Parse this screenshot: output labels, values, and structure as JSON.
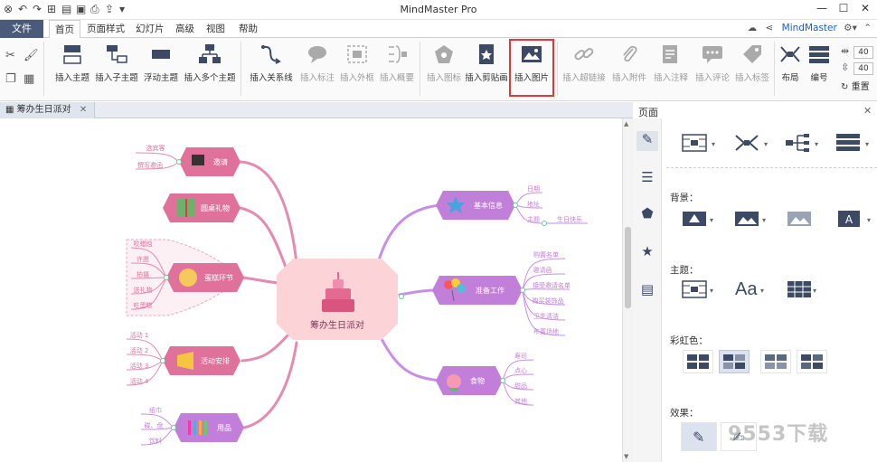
{
  "titlebar": {
    "app_title": "MindMaster Pro",
    "quick_access": [
      "app-logo-icon",
      "undo-icon",
      "redo-icon",
      "new-icon",
      "open-icon",
      "save-icon",
      "print-icon",
      "export-icon",
      "more-icon"
    ]
  },
  "menu": {
    "file": "文件",
    "tabs": [
      "首页",
      "页面样式",
      "幻灯片",
      "高级",
      "视图",
      "帮助"
    ],
    "active_tab": "首页",
    "user": "MindMaster"
  },
  "ribbon": {
    "buttons": [
      {
        "id": "insert-topic",
        "label": "插入主题"
      },
      {
        "id": "insert-subtopic",
        "label": "插入子主题"
      },
      {
        "id": "floating-topic",
        "label": "浮动主题"
      },
      {
        "id": "insert-multiple-topics",
        "label": "插入多个主题"
      },
      {
        "id": "insert-relationship",
        "label": "插入关系线"
      },
      {
        "id": "insert-callout",
        "label": "插入标注"
      },
      {
        "id": "insert-boundary",
        "label": "插入外框"
      },
      {
        "id": "insert-summary",
        "label": "插入概要"
      },
      {
        "id": "insert-icon",
        "label": "插入图标"
      },
      {
        "id": "insert-clipart",
        "label": "插入剪贴画"
      },
      {
        "id": "insert-picture",
        "label": "插入图片"
      },
      {
        "id": "insert-hyperlink",
        "label": "插入超链接"
      },
      {
        "id": "insert-attachment",
        "label": "插入附件"
      },
      {
        "id": "insert-note",
        "label": "插入注释"
      },
      {
        "id": "insert-comment",
        "label": "插入评论"
      },
      {
        "id": "insert-tag",
        "label": "插入标签"
      },
      {
        "id": "layout",
        "label": "布局"
      },
      {
        "id": "numbering",
        "label": "编号"
      },
      {
        "id": "reset",
        "label": "重置"
      }
    ],
    "spacing_h": "40",
    "spacing_v": "40"
  },
  "doc": {
    "tab_title": "筹办生日派对"
  },
  "mindmap": {
    "center": "筹办生日派对",
    "left_topics": [
      {
        "label": "邀请",
        "children": [
          "选宾客",
          "撰写邀函"
        ]
      },
      {
        "label": "圆桌礼物",
        "children": []
      },
      {
        "label": "蛋糕环节",
        "children": [
          "吹蜡烛",
          "许愿",
          "拍摄",
          "送礼物",
          "吃蛋糕"
        ]
      },
      {
        "label": "活动安排",
        "children": [
          "活动 1",
          "活动 2",
          "活动 3",
          "活动 4"
        ]
      },
      {
        "label": "用品",
        "children": [
          "纸巾",
          "碟、盘",
          "饮料"
        ]
      }
    ],
    "right_topics": [
      {
        "label": "基本信息",
        "children": [
          "日期",
          "地址",
          "主题"
        ],
        "extra": "生日快乐"
      },
      {
        "label": "准备工作",
        "children": [
          "购置名单",
          "邀请函",
          "接受邀请名单",
          "购买装饰品",
          "卫生清洁",
          "布置场地"
        ]
      },
      {
        "label": "食物",
        "children": [
          "寿司",
          "点心",
          "甜品",
          "其他"
        ]
      }
    ]
  },
  "panel": {
    "title": "页面",
    "sections": {
      "background": "背景：",
      "theme": "主题：",
      "rainbow": "彩虹色：",
      "effect": "效果："
    },
    "sidebar_icons": [
      "format-pen-icon",
      "outline-list-icon",
      "icon-gallery-icon",
      "clipart-icon",
      "task-icon"
    ]
  },
  "watermark": "9553下载",
  "colors": {
    "accent": "#4a5a7a",
    "topic_pink": "#e0719b",
    "topic_purple": "#c27fd9",
    "center_fill": "#fcd4d8",
    "branch_left": "#e58ab0",
    "branch_right": "#c98ee6",
    "highlight": "#e03a3a"
  }
}
